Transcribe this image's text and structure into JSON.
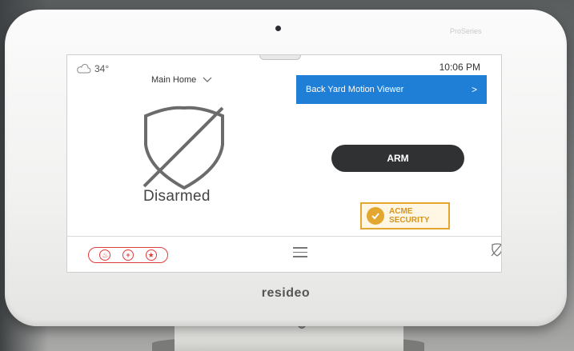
{
  "device": {
    "series_label": "ProSeries",
    "brand": "resideo"
  },
  "header": {
    "temperature": "34°",
    "location": "Main Home",
    "time": "10:06 PM"
  },
  "camera_button": {
    "label": "Back Yard Motion Viewer",
    "chevron": ">"
  },
  "status": {
    "label": "Disarmed"
  },
  "arm_button": {
    "label": "ARM"
  },
  "dealer_logo": {
    "line1": "ACME",
    "line2": "SECURITY"
  },
  "footer": {
    "emergency_icons": [
      "fire-icon",
      "medical-icon",
      "police-icon"
    ]
  },
  "colors": {
    "accent_blue": "#1f7fd6",
    "arm_dark": "#2f3133",
    "emergency_red": "#e23b3b",
    "logo_gold": "#e3a72f"
  }
}
